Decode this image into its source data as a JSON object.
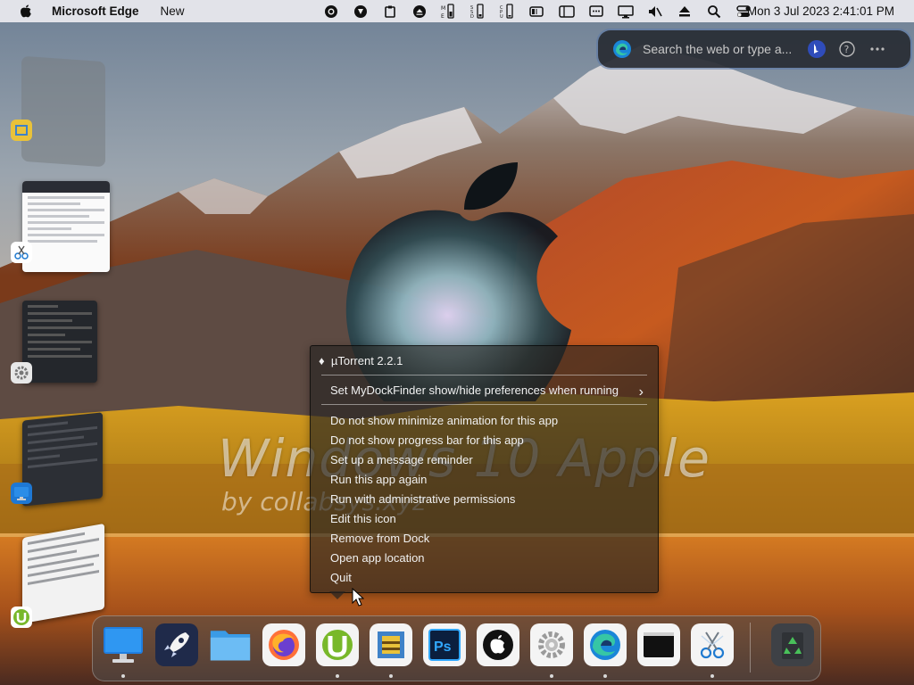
{
  "menubar": {
    "app_name": "Microsoft Edge",
    "menu_new": "New",
    "clock": "Mon 3 Jul 2023 2:41:01 PM",
    "tray_icons": [
      "obs-icon",
      "copilot-icon",
      "clipboard-icon",
      "eject-disc-icon",
      "mem-meter-icon",
      "ssd-meter-icon",
      "cpu-meter-icon",
      "battery-icon",
      "window-icon",
      "chat-icon",
      "display-icon",
      "mute-icon",
      "eject-icon",
      "search-icon",
      "control-center-icon"
    ]
  },
  "edge_search": {
    "placeholder": "Search the web or type a..."
  },
  "watermark": {
    "line1": "Windows 10 Apple",
    "line2": "by collabsys.xyz"
  },
  "context_menu": {
    "header": "µTorrent 2.2.1",
    "submenu_item": "Set MyDockFinder show/hide preferences when running",
    "items": [
      "Do not show minimize animation for this app",
      "Do not show progress bar for this app",
      "Set up a message reminder",
      "Run this app again",
      "Run with administrative permissions",
      "Edit this icon",
      "Remove from Dock",
      "Open app location",
      "Quit"
    ]
  },
  "dock": {
    "items": [
      {
        "name": "finder",
        "icon": "monitor-icon",
        "running": true
      },
      {
        "name": "launchpad",
        "icon": "rocket-icon",
        "running": false
      },
      {
        "name": "files",
        "icon": "folder-icon",
        "running": false
      },
      {
        "name": "firefox",
        "icon": "firefox-icon",
        "running": false
      },
      {
        "name": "utorrent",
        "icon": "utorrent-icon",
        "running": true
      },
      {
        "name": "winrar",
        "icon": "archive-icon",
        "running": true
      },
      {
        "name": "photoshop",
        "icon": "photoshop-icon",
        "running": false
      },
      {
        "name": "apple",
        "icon": "apple-icon",
        "running": false
      },
      {
        "name": "settings",
        "icon": "gear-icon",
        "running": true
      },
      {
        "name": "edge",
        "icon": "edge-icon",
        "running": true
      },
      {
        "name": "terminal",
        "icon": "terminal-icon",
        "running": false
      },
      {
        "name": "snipping",
        "icon": "scissors-icon",
        "running": true
      }
    ],
    "trash": {
      "icon": "recycle-bin-icon"
    }
  },
  "colors": {
    "menubar_bg": "#ececf0",
    "menu_bg": "#262421",
    "edge_blue": "#1a86d8",
    "utorrent_green": "#78b82a"
  }
}
